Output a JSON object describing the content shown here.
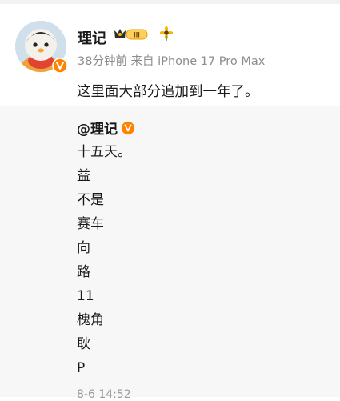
{
  "post": {
    "username": "理记",
    "level_text": "III",
    "time": "38分钟前",
    "source_prefix": "来自",
    "device": "iPhone 17 Pro Max",
    "text": "这里面大部分追加到一年了。"
  },
  "repost": {
    "author": "@理记",
    "lines": [
      "十五天。",
      "益",
      "不是",
      "赛车",
      "向",
      "路",
      "11",
      "槐角",
      "耿",
      "P"
    ],
    "timestamp": "8-6 14:52"
  },
  "colors": {
    "verified": "#ff8200",
    "meta": "#8c8c8c",
    "repost_bg": "#f7f7f7"
  }
}
